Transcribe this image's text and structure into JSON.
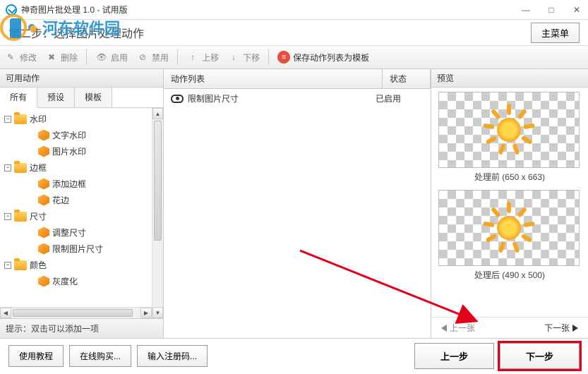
{
  "window": {
    "title": "神奇图片批处理 1.0 - 试用版",
    "min": "—",
    "max": "□",
    "close": "✕"
  },
  "watermark": "河东软件园",
  "header": {
    "step_title": "第二步：选择图片处理动作",
    "main_menu": "主菜单"
  },
  "toolbar": {
    "modify": "修改",
    "delete": "删除",
    "enable": "启用",
    "disable": "禁用",
    "move_up": "上移",
    "move_down": "下移",
    "save_template": "保存动作列表为模板"
  },
  "left": {
    "title": "可用动作",
    "tabs": [
      "所有",
      "预设",
      "模板"
    ],
    "tree": {
      "watermark": {
        "label": "水印",
        "children": [
          "文字水印",
          "图片水印"
        ]
      },
      "border": {
        "label": "边框",
        "children": [
          "添加边框",
          "花边"
        ]
      },
      "size": {
        "label": "尺寸",
        "children": [
          "调整尺寸",
          "限制图片尺寸"
        ]
      },
      "color": {
        "label": "颜色",
        "children": [
          "灰度化"
        ]
      }
    },
    "hint": "提示：双击可以添加一项"
  },
  "mid": {
    "col_action": "动作列表",
    "col_status": "状态",
    "rows": [
      {
        "name": "限制图片尺寸",
        "status": "已启用"
      }
    ]
  },
  "right": {
    "title": "预览",
    "before": "处理前 (650 x 663)",
    "after": "处理后 (490 x 500)",
    "prev_img": "上一张",
    "next_img": "下一张"
  },
  "footer": {
    "tutorial": "使用教程",
    "buy": "在线购买...",
    "register": "输入注册码...",
    "prev": "上一步",
    "next": "下一步"
  }
}
